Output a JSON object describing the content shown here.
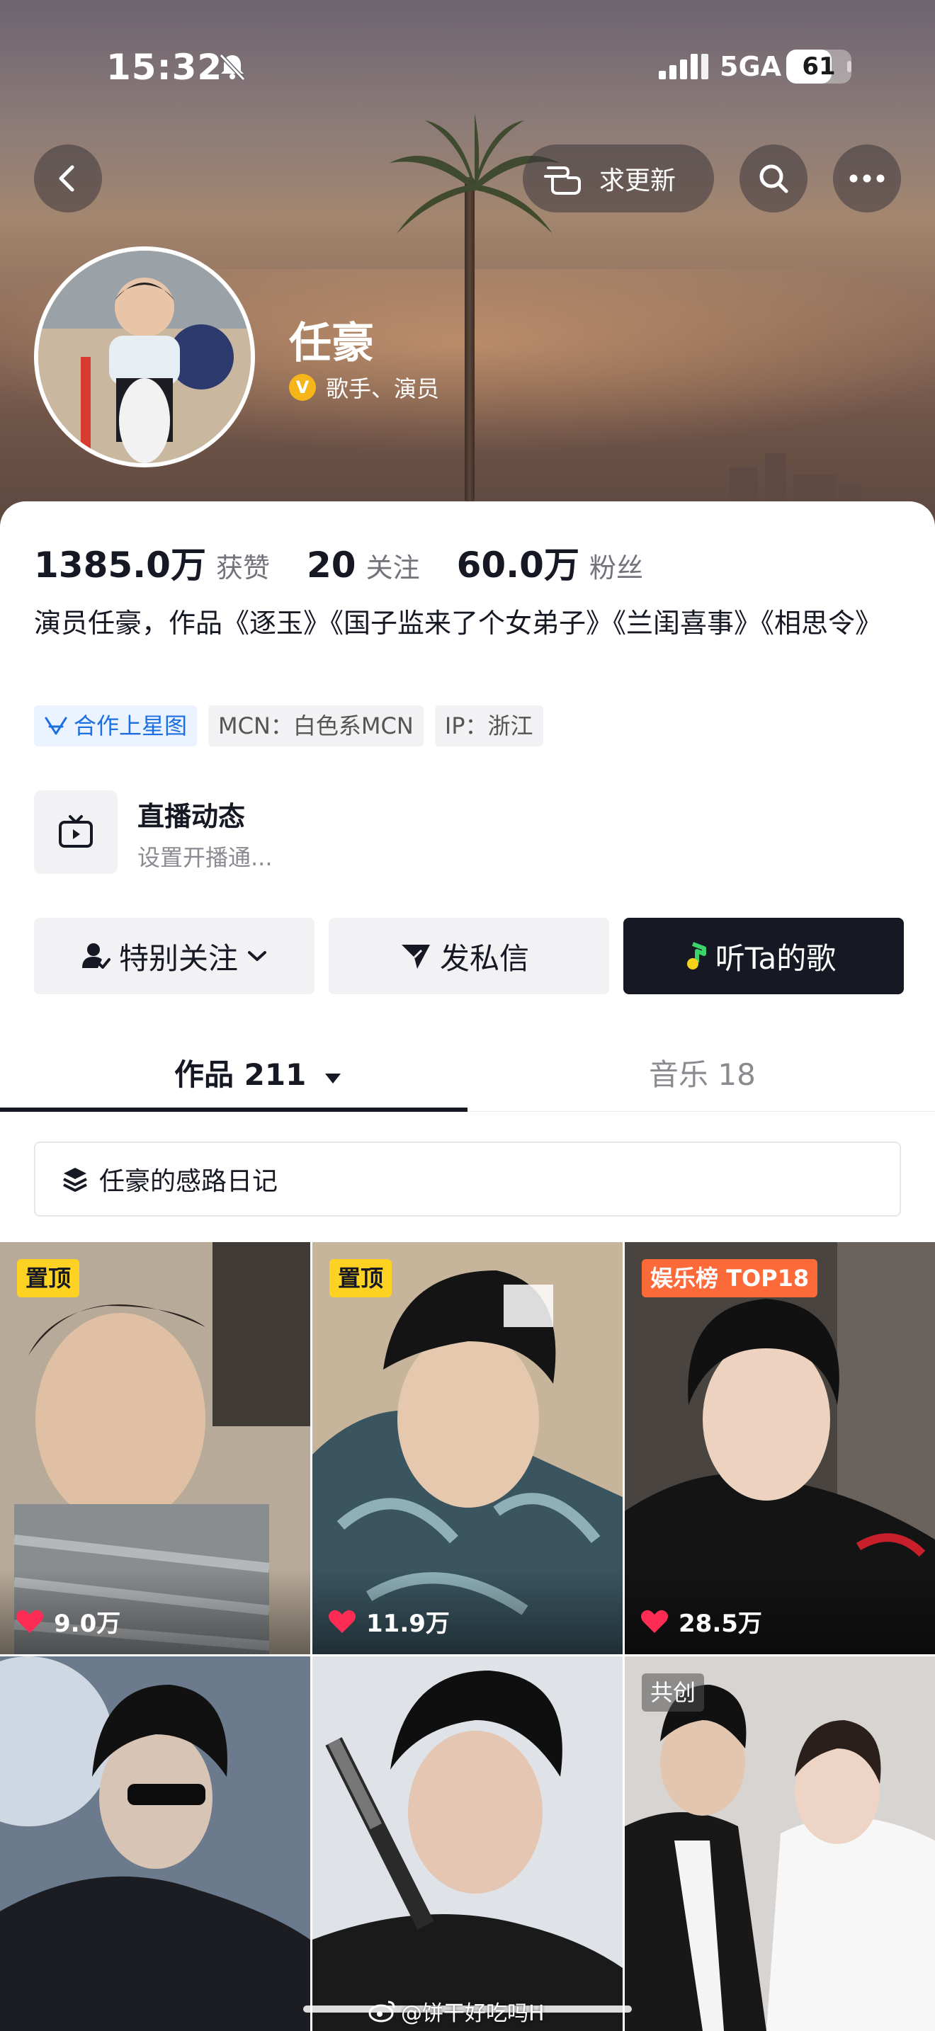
{
  "status_bar": {
    "time": "15:32",
    "network": "5GA",
    "battery": "61"
  },
  "header": {
    "request_update_label": "求更新"
  },
  "profile": {
    "name": "任豪",
    "verification": "歌手、演员",
    "verify_badge": "V"
  },
  "stats": [
    {
      "value": "1385.0万",
      "label": "获赞"
    },
    {
      "value": "20",
      "label": "关注"
    },
    {
      "value": "60.0万",
      "label": "粉丝"
    }
  ],
  "bio": "演员任豪，作品《逐玉》《国子监来了个女弟子》《兰闺喜事》《相思令》",
  "tags": [
    {
      "text": "合作上星图"
    },
    {
      "text": "MCN：白色系MCN"
    },
    {
      "text": "IP：浙江"
    }
  ],
  "live": {
    "title": "直播动态",
    "subtitle": "设置开播通..."
  },
  "actions": {
    "follow_label": "特别关注",
    "message_label": "发私信",
    "music_label": "听Ta的歌"
  },
  "tabs": [
    {
      "label": "作品 211"
    },
    {
      "label": "音乐 18"
    }
  ],
  "collection": {
    "title": "任豪的感路日记"
  },
  "videos": [
    {
      "badge": "置顶",
      "likes": "9.0万"
    },
    {
      "badge": "置顶",
      "likes": "11.9万"
    },
    {
      "badge": "娱乐榜 TOP18",
      "likes": "28.5万"
    },
    {
      "badge": "",
      "likes": ""
    },
    {
      "badge": "",
      "likes": ""
    },
    {
      "badge": "共创",
      "likes": ""
    }
  ],
  "watermark": "@饼干好吃吗H",
  "colors": {
    "accent_dark": "#161823",
    "pin_yellow": "#fdd223",
    "rank_orange": "#fd6a3a",
    "link_blue": "#1c6fe0",
    "like_red": "#fe2c55"
  }
}
